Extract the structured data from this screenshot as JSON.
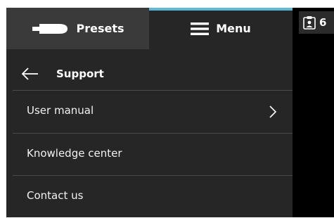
{
  "tabs": {
    "presets_label": "Presets",
    "menu_label": "Menu",
    "active": "Menu"
  },
  "support": {
    "title": "Support",
    "items": [
      {
        "label": "User manual",
        "has_chevron": true
      },
      {
        "label": "Knowledge center",
        "has_chevron": false
      },
      {
        "label": "Contact us",
        "has_chevron": false
      }
    ]
  },
  "badge": {
    "count": "6",
    "icon": "clipboard-user-icon"
  },
  "colors": {
    "panel_bg": "#262626",
    "inactive_tab_bg": "#3a3a3a",
    "active_tab_indicator": "#5fb7d6",
    "divider": "#4a4a4a",
    "right_bg": "#000000"
  }
}
